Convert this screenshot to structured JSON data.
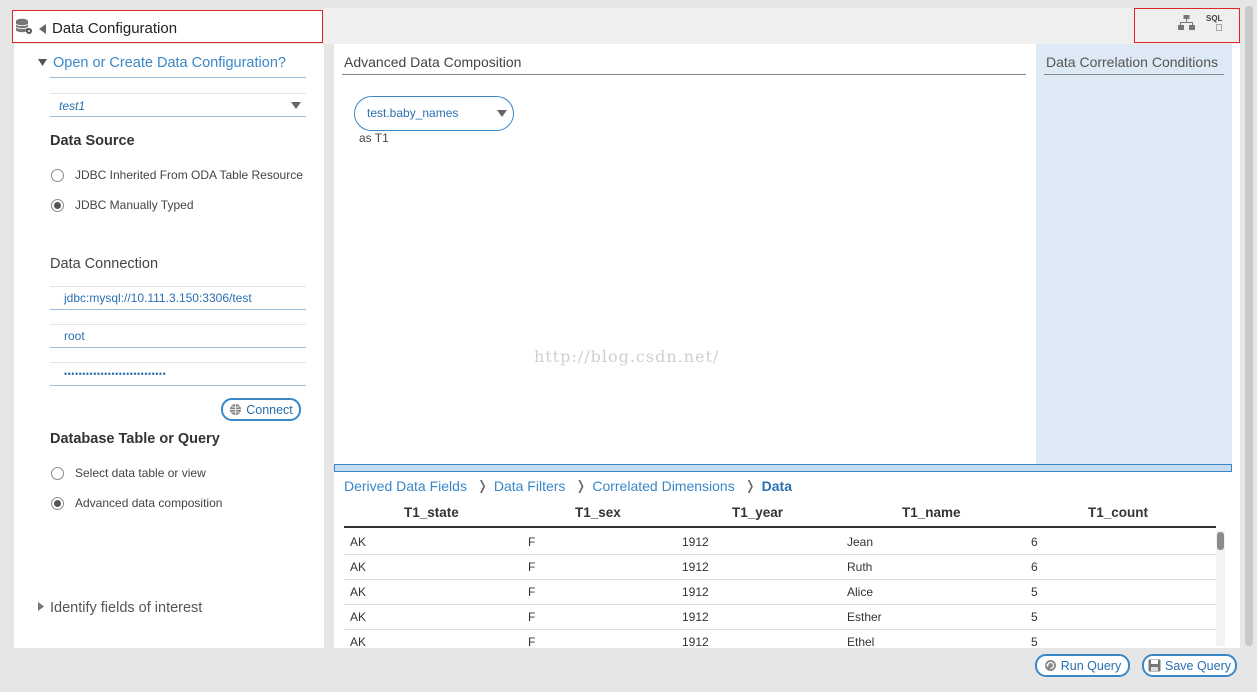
{
  "header": {
    "title": "Data Configuration",
    "db_icon": "database-gear-icon",
    "collapse_icon": "triangle-left-icon",
    "tools": {
      "hierarchy_icon": "hierarchy-icon",
      "sql_label": "SQL"
    }
  },
  "left": {
    "open_create_label": "Open or Create Data Configuration?",
    "config_select_value": "test1",
    "data_source": {
      "heading": "Data Source",
      "options": [
        "JDBC Inherited From ODA Table Resource",
        "JDBC Manually Typed"
      ],
      "selected_index": 1
    },
    "data_connection": {
      "heading": "Data Connection",
      "url": "jdbc:mysql://10.111.3.150:3306/test",
      "user": "root",
      "password_mask": "••••••••••••••••••••••••••••",
      "connect_label": "Connect"
    },
    "table_or_query": {
      "heading": "Database Table or Query",
      "options": [
        "Select data table or view",
        "Advanced data composition"
      ],
      "selected_index": 1
    },
    "identify_label": "Identify fields of interest"
  },
  "composition": {
    "title": "Advanced Data Composition",
    "table_select": "test.baby_names",
    "alias": "as T1",
    "watermark": "http://blog.csdn.net/"
  },
  "correlation": {
    "title": "Data Correlation Conditions"
  },
  "breadcrumb": {
    "items": [
      "Derived Data Fields",
      "Data Filters",
      "Correlated Dimensions",
      "Data"
    ],
    "separator": "❭",
    "active_index": 3
  },
  "table": {
    "columns": [
      "T1_state",
      "T1_sex",
      "T1_year",
      "T1_name",
      "T1_count"
    ],
    "rows": [
      [
        "AK",
        "F",
        "1912",
        "Jean",
        "6"
      ],
      [
        "AK",
        "F",
        "1912",
        "Ruth",
        "6"
      ],
      [
        "AK",
        "F",
        "1912",
        "Alice",
        "5"
      ],
      [
        "AK",
        "F",
        "1912",
        "Esther",
        "5"
      ],
      [
        "AK",
        "F",
        "1912",
        "Ethel",
        "5"
      ]
    ]
  },
  "footer": {
    "run_label": "Run Query",
    "save_label": "Save Query"
  },
  "colors": {
    "accent": "#3a87c8",
    "highlight_box": "#e0262b",
    "correlation_bg": "#dde9f4"
  }
}
